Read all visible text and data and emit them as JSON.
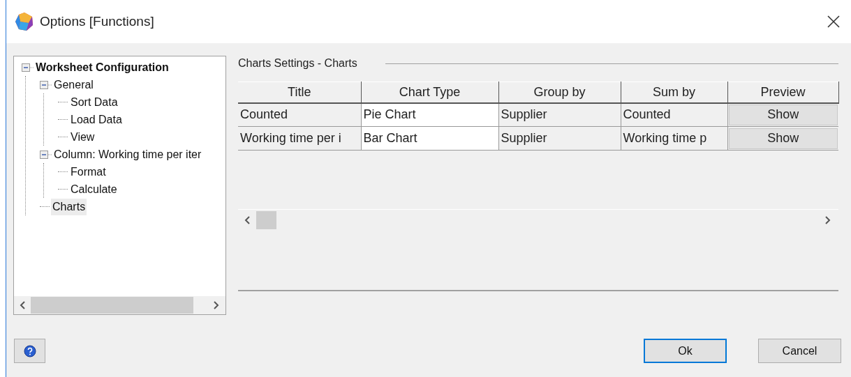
{
  "window": {
    "title": "Options [Functions]"
  },
  "tree": [
    {
      "label": "Worksheet Configuration",
      "expanded": true,
      "selected": false,
      "children": [
        {
          "label": "General",
          "expanded": true,
          "selected": false,
          "children": [
            {
              "label": "Sort Data",
              "selected": false
            },
            {
              "label": "Load Data",
              "selected": false
            },
            {
              "label": "View",
              "selected": false
            }
          ]
        },
        {
          "label": "Column: Working time per iter",
          "expanded": true,
          "selected": false,
          "children": [
            {
              "label": "Format",
              "selected": false
            },
            {
              "label": "Calculate",
              "selected": false
            }
          ]
        },
        {
          "label": "Charts",
          "selected": true
        }
      ]
    }
  ],
  "section_title": "Charts Settings - Charts",
  "table": {
    "columns": [
      "Title",
      "Chart Type",
      "Group by",
      "Sum by",
      "Preview"
    ],
    "rows": [
      {
        "cells": [
          "Counted",
          "Pie Chart",
          "Supplier",
          "Counted"
        ],
        "button": "Show"
      },
      {
        "cells": [
          "Working time per i",
          "Bar Chart",
          "Supplier",
          "Working time p"
        ],
        "button": "Show"
      }
    ]
  },
  "buttons": [
    {
      "label": "Ok",
      "default": true
    },
    {
      "label": "Cancel",
      "default": false
    }
  ]
}
